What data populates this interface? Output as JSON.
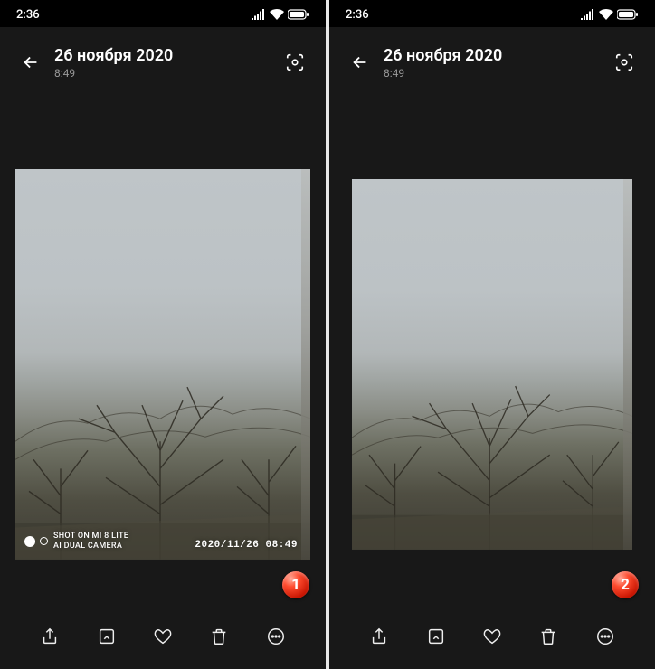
{
  "statusbar": {
    "time": "2:36"
  },
  "header": {
    "date": "26 ноября 2020",
    "time": "8:49"
  },
  "watermark": {
    "line1": "SHOT ON MI 8 LITE",
    "line2": "AI DUAL CAMERA",
    "timestamp": "2020/11/26  08:49"
  },
  "badges": {
    "left": "1",
    "right": "2"
  },
  "icons": {
    "back": "arrow-left",
    "lens": "google-lens",
    "share": "share",
    "edit": "edit",
    "favorite": "heart",
    "delete": "trash",
    "more": "more-horizontal"
  }
}
